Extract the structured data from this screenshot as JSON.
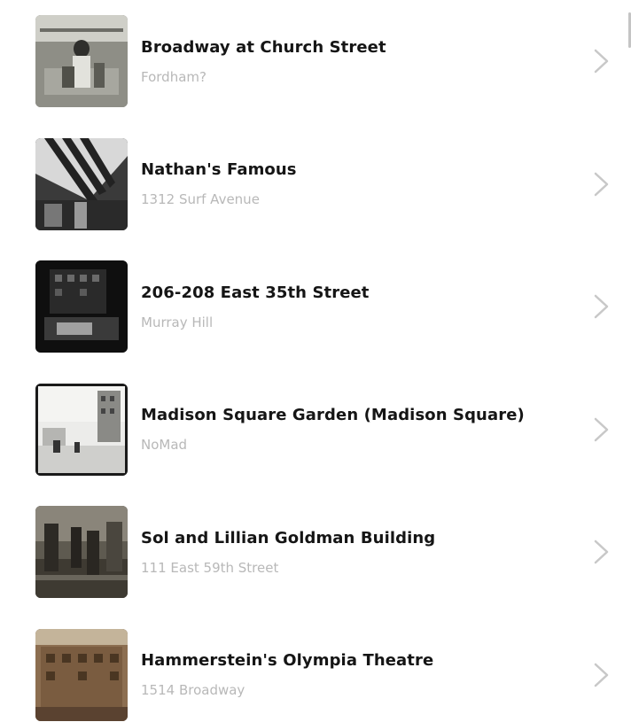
{
  "items": [
    {
      "title": "Broadway at Church Street",
      "subtitle": "Fordham?",
      "thumb_icon": "photo-crowd-field-icon"
    },
    {
      "title": "Nathan's Famous",
      "subtitle": "1312 Surf Avenue",
      "thumb_icon": "photo-awning-icon"
    },
    {
      "title": "206-208 East 35th Street",
      "subtitle": "Murray Hill",
      "thumb_icon": "photo-building-night-icon"
    },
    {
      "title": "Madison Square Garden (Madison Square)",
      "subtitle": "NoMad",
      "thumb_icon": "photo-street-scene-icon"
    },
    {
      "title": "Sol and Lillian Goldman Building",
      "subtitle": "111 East 59th Street",
      "thumb_icon": "photo-street-people-icon"
    },
    {
      "title": "Hammerstein's Olympia Theatre",
      "subtitle": "1514 Broadway",
      "thumb_icon": "photo-theatre-icon"
    }
  ],
  "chevron_icon": "chevron-right-icon",
  "colors": {
    "title": "#151515",
    "subtitle": "#b8b8b8",
    "chevron": "#c8c8c8"
  }
}
